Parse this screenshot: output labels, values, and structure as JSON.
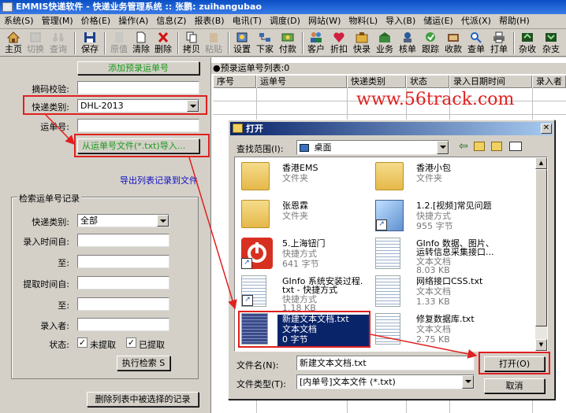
{
  "app": {
    "title": "EMMIS快递软件 - 快递业务管理系统 :: 张鹏: zuihangubao"
  },
  "menu": [
    "系统(S)",
    "管理(M)",
    "价格(E)",
    "操作(A)",
    "信息(Z)",
    "报表(B)",
    "电讯(T)",
    "调度(D)",
    "网站(W)",
    "物料(L)",
    "导入(B)",
    "储运(E)",
    "代派(X)",
    "帮助(H)"
  ],
  "toolbar": {
    "items": [
      {
        "label": "主页",
        "icon": "home-icon",
        "enabled": true
      },
      {
        "label": "切换",
        "icon": "switch-icon",
        "enabled": false
      },
      {
        "label": "查询",
        "icon": "binoculars-icon",
        "enabled": false
      },
      {
        "label": "保存",
        "icon": "floppy-icon",
        "enabled": true
      },
      {
        "label": "原值",
        "icon": "restore-icon",
        "enabled": false
      },
      {
        "label": "清除",
        "icon": "new-page-icon",
        "enabled": true
      },
      {
        "label": "删除",
        "icon": "delete-x-icon",
        "enabled": true
      },
      {
        "label": "拷贝",
        "icon": "copy-icon",
        "enabled": true
      },
      {
        "label": "粘贴",
        "icon": "paste-icon",
        "enabled": false
      },
      {
        "label": "设置",
        "icon": "settings-icon",
        "enabled": true
      },
      {
        "label": "下家",
        "icon": "network-icon",
        "enabled": true
      },
      {
        "label": "付款",
        "icon": "payment-icon",
        "enabled": true
      },
      {
        "label": "客户",
        "icon": "users-icon",
        "enabled": true
      },
      {
        "label": "折扣",
        "icon": "discount-heart-icon",
        "enabled": true
      },
      {
        "label": "快录",
        "icon": "quick-entry-icon",
        "enabled": true
      },
      {
        "label": "业务",
        "icon": "business-icon",
        "enabled": true
      },
      {
        "label": "核单",
        "icon": "verify-icon",
        "enabled": true
      },
      {
        "label": "跟踪",
        "icon": "track-icon",
        "enabled": true
      },
      {
        "label": "收款",
        "icon": "receive-icon",
        "enabled": true
      },
      {
        "label": "查单",
        "icon": "search-order-icon",
        "enabled": true
      },
      {
        "label": "打单",
        "icon": "print-icon",
        "enabled": true
      },
      {
        "label": "杂收",
        "icon": "misc-income-icon",
        "enabled": true
      },
      {
        "label": "杂支",
        "icon": "misc-expense-icon",
        "enabled": true
      }
    ]
  },
  "entry": {
    "add_button": "添加预录运单号",
    "checksum_label": "摘码校验:",
    "express_type_label": "快递类别:",
    "express_type_value": "DHL-2013",
    "waybill_label": "运单号:",
    "import_button": "从运单号文件(*.txt)导入...",
    "export_link": "导出列表记录到文件"
  },
  "search": {
    "group_title": "检索运单号记录",
    "express_type_label": "快递类别:",
    "express_type_value": "全部",
    "entry_from_label": "录入时间自:",
    "to1_label": "至:",
    "extract_from_label": "提取时间自:",
    "to2_label": "至:",
    "entered_by_label": "录入者:",
    "status_label": "状态:",
    "not_extracted": "未提取",
    "extracted": "已提取",
    "search_button": "执行检索 S",
    "delete_button": "删除列表中被选择的记录"
  },
  "list": {
    "header": "●预录运单号列表:0",
    "columns": [
      "序号",
      "运单号",
      "快递类别",
      "状态",
      "录入日期时间",
      "录入者"
    ]
  },
  "watermark": "www.56track.com",
  "dialog": {
    "title": "打开",
    "look_in_label": "查找范围(I):",
    "look_in_value": "桌面",
    "files": [
      {
        "name": "香港EMS",
        "sub1": "文件夹",
        "sub2": "",
        "sub3": "",
        "type": "folder"
      },
      {
        "name": "香港小包",
        "sub1": "文件夹",
        "sub2": "",
        "sub3": "",
        "type": "folder"
      },
      {
        "name": "张恩霖",
        "sub1": "文件夹",
        "sub2": "",
        "sub3": "",
        "type": "folder"
      },
      {
        "name": "1.2.[视频]常见问题",
        "sub1": "快捷方式",
        "sub2": "955 字节",
        "sub3": "",
        "type": "video-shortcut"
      },
      {
        "name": "5.上海钮门",
        "sub1": "快捷方式",
        "sub2": "641 字节",
        "sub3": "",
        "type": "app-shortcut"
      },
      {
        "name": "GInfo 数据、图片、",
        "sub1": "运转信息采集接口...",
        "sub2": "文本文档",
        "sub3": "8.03 KB",
        "type": "txt"
      },
      {
        "name": "GInfo 系统安装过程.",
        "sub1": "txt - 快捷方式",
        "sub2": "快捷方式",
        "sub3": "1.18 KB",
        "type": "txt-shortcut"
      },
      {
        "name": "网络接口CSS.txt",
        "sub1": "文本文档",
        "sub2": "1.33 KB",
        "sub3": "",
        "type": "txt"
      },
      {
        "name": "新建文本文档.txt",
        "sub1": "文本文档",
        "sub2": "0 字节",
        "sub3": "",
        "type": "txt-selected"
      },
      {
        "name": "修复数据库.txt",
        "sub1": "文本文档",
        "sub2": "2.75 KB",
        "sub3": "",
        "type": "txt"
      }
    ],
    "filename_label": "文件名(N):",
    "filename_value": "新建文本文档.txt",
    "filetype_label": "文件类型(T):",
    "filetype_value": "[内单号]文本文件 (*.txt)",
    "open_button": "打开(O)",
    "cancel_button": "取消"
  },
  "colors": {
    "accent_red": "#e02020",
    "title_blue": "#0a246a",
    "green_text": "#1a9a1a",
    "link_blue": "#1010c0",
    "selection": "#0a246a"
  }
}
